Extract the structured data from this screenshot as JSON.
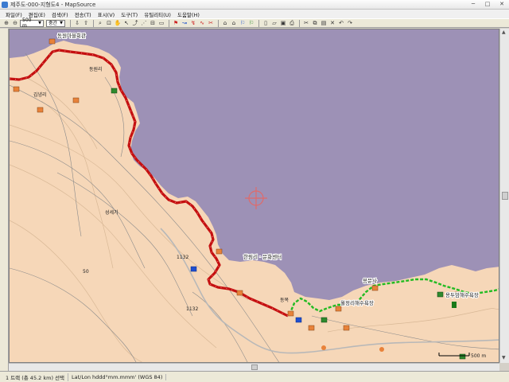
{
  "window": {
    "title": "제주도-000-지형도4 - MapSource"
  },
  "menubar": {
    "items": [
      "파일(F)",
      "편집(E)",
      "검색(F)",
      "전송(T)",
      "표시(V)",
      "도구(T)",
      "유틸리티(U)",
      "도움말(H)"
    ]
  },
  "toolbar": {
    "zoom_value": "500 m",
    "detail_value": "중간"
  },
  "map": {
    "labels": {
      "place_nw": "동원마을회관",
      "place_n": "동원리",
      "place_w": "김녕리",
      "place_mid": "성세기",
      "place_c": "한림리 · 문화센터",
      "place_s": "동복",
      "place_se": "월정리해수욕장",
      "place_e": "용문사",
      "place_far_e": "용두암해수욕장",
      "scale": "500 m",
      "road_1": "1132",
      "road_2": "1132",
      "road_3": "50"
    },
    "colors": {
      "sea": "#9d91b6",
      "land": "#f6d7b8",
      "route_red": "#c41010",
      "route_green": "#22bb22"
    }
  },
  "status": {
    "segment": "1 트랙 (총 45.2 km) 선택",
    "coord_format": "Lat/Lon hddd°mm.mmm' (WGS 84)"
  }
}
